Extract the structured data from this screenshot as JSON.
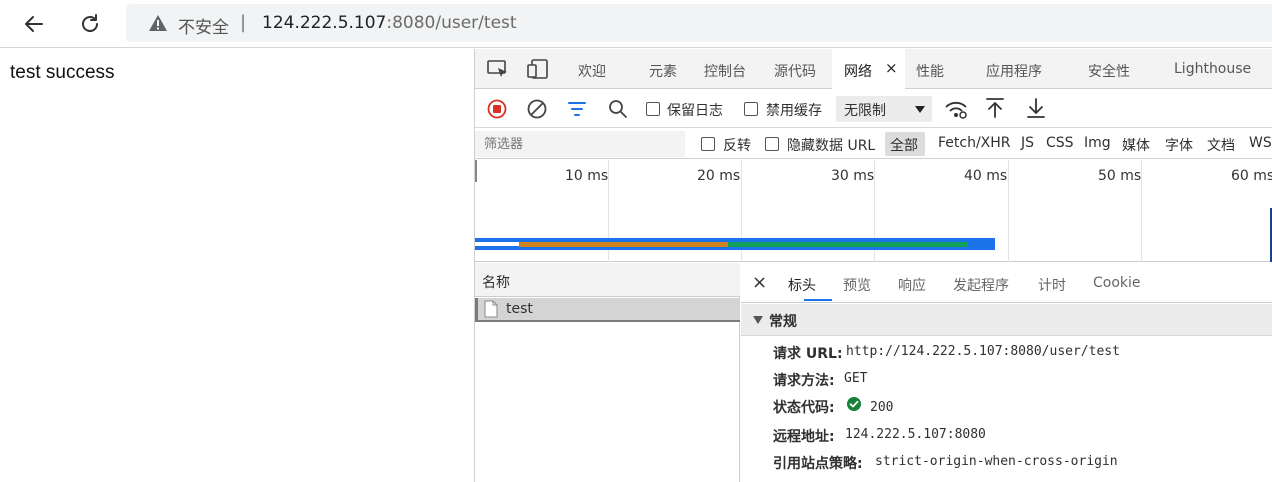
{
  "browser": {
    "security_label": "不安全",
    "separator": "|",
    "url_host": "124.222.5.107",
    "url_rest": ":8080/user/test"
  },
  "page": {
    "body_text": "test success"
  },
  "devtools": {
    "tabs": [
      {
        "label": "欢迎"
      },
      {
        "label": "元素"
      },
      {
        "label": "控制台"
      },
      {
        "label": "源代码"
      },
      {
        "label": "网络",
        "active": true
      },
      {
        "label": "性能"
      },
      {
        "label": "应用程序"
      },
      {
        "label": "安全性"
      },
      {
        "label": "Lighthouse"
      }
    ],
    "close_glyph": "×",
    "toolbar": {
      "preserve_log_label": "保留日志",
      "disable_cache_label": "禁用缓存",
      "throttle_value": "无限制"
    },
    "filter": {
      "placeholder": "筛选器",
      "invert_label": "反转",
      "hide_data_urls_label": "隐藏数据 URL",
      "types": [
        "全部",
        "Fetch/XHR",
        "JS",
        "CSS",
        "Img",
        "媒体",
        "字体",
        "文档",
        "WS"
      ]
    },
    "overview": {
      "ticks": [
        "10 ms",
        "20 ms",
        "30 ms",
        "40 ms",
        "50 ms",
        "60 ms"
      ],
      "waterfall_ms": {
        "queue_end": 3.3,
        "wait_end": 19.0,
        "download_end": 37.0,
        "total_end": 39.0
      }
    },
    "requests": {
      "column_header": "名称",
      "rows": [
        {
          "name": "test"
        }
      ]
    },
    "detail": {
      "close_glyph": "×",
      "tabs": [
        "标头",
        "预览",
        "响应",
        "发起程序",
        "计时",
        "Cookie"
      ],
      "section_title": "常规",
      "fields": [
        {
          "key": "请求 URL:",
          "value": "http://124.222.5.107:8080/user/test"
        },
        {
          "key": "请求方法:",
          "value": "GET"
        },
        {
          "key": "状态代码:",
          "value": "200"
        },
        {
          "key": "远程地址:",
          "value": "124.222.5.107:8080"
        },
        {
          "key": "引用站点策略:",
          "value": "strict-origin-when-cross-origin"
        }
      ]
    },
    "colors": {
      "accent": "#1a73e8",
      "waterfall_queue": "#ffffff",
      "waterfall_wait": "#d0821f",
      "waterfall_download": "#119f5b",
      "waterfall_total": "#1a73e8",
      "status_ok": "#188038",
      "record": "#d93025"
    }
  }
}
